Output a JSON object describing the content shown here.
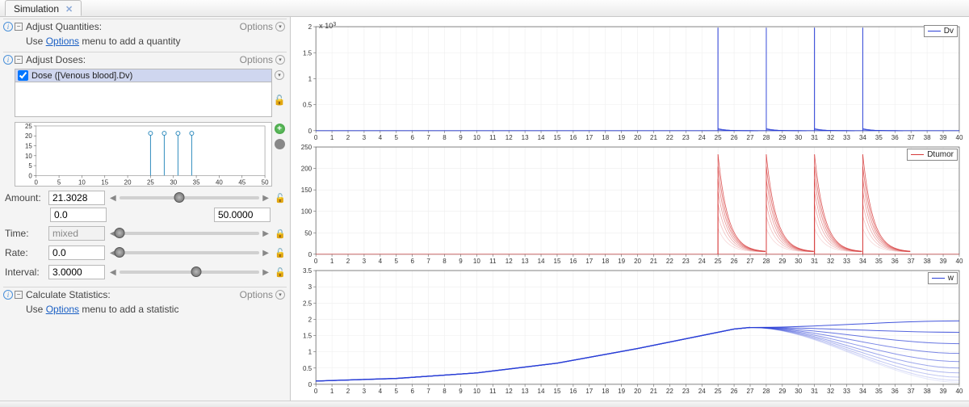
{
  "tabs": {
    "simulation": "Simulation"
  },
  "sections": {
    "quantities": {
      "title": "Adjust Quantities:",
      "hint_pre": "Use ",
      "hint_link": "Options",
      "hint_post": " menu to add a quantity",
      "options": "Options"
    },
    "doses": {
      "title": "Adjust Doses:",
      "options": "Options"
    },
    "stats": {
      "title": "Calculate Statistics:",
      "hint_pre": "Use ",
      "hint_link": "Options",
      "hint_post": " menu to add a statistic",
      "options": "Options"
    }
  },
  "dose_items": [
    {
      "label": "Dose ([Venous blood].Dv)",
      "checked": true
    }
  ],
  "mini_axis": {
    "x_ticks": [
      "0",
      "5",
      "10",
      "15",
      "20",
      "25",
      "30",
      "35",
      "40",
      "45",
      "50"
    ],
    "y_ticks": [
      "0",
      "5",
      "10",
      "15",
      "20",
      "25"
    ]
  },
  "params": {
    "amount": {
      "label": "Amount:",
      "value": "21.3028",
      "slider": 0.43,
      "min": "0.0",
      "max": "50.0000",
      "locked": false
    },
    "time": {
      "label": "Time:",
      "value": "mixed",
      "slider": 0.0,
      "locked": true
    },
    "rate": {
      "label": "Rate:",
      "value": "0.0",
      "slider": 0.0,
      "locked": false
    },
    "interval": {
      "label": "Interval:",
      "value": "3.0000",
      "slider": 0.55,
      "locked": false
    }
  },
  "chart_data": [
    {
      "type": "line",
      "title": "",
      "legend": "Dv",
      "color": "#2a3fd6",
      "xlim": [
        0,
        40
      ],
      "ylim": [
        0,
        2000
      ],
      "y_scale_label": "x 10",
      "y_scale_exp": "3",
      "x_ticks": [
        0,
        1,
        2,
        3,
        4,
        5,
        6,
        7,
        8,
        9,
        10,
        11,
        12,
        13,
        14,
        15,
        16,
        17,
        18,
        19,
        20,
        21,
        22,
        23,
        24,
        25,
        26,
        27,
        28,
        29,
        30,
        31,
        32,
        33,
        34,
        35,
        36,
        37,
        38,
        39,
        40
      ],
      "y_ticks": [
        0,
        500,
        1000,
        1500,
        2000
      ],
      "y_tick_labels": [
        "0",
        "0.5",
        "1",
        "1.5",
        "2"
      ],
      "dose_spikes_x": [
        25,
        28,
        31,
        34
      ],
      "spike_height": 1980
    },
    {
      "type": "line",
      "title": "",
      "legend": "Dtumor",
      "color": "#d63a3a",
      "xlim": [
        0,
        40
      ],
      "ylim": [
        0,
        250
      ],
      "x_ticks": [
        0,
        1,
        2,
        3,
        4,
        5,
        6,
        7,
        8,
        9,
        10,
        11,
        12,
        13,
        14,
        15,
        16,
        17,
        18,
        19,
        20,
        21,
        22,
        23,
        24,
        25,
        26,
        27,
        28,
        29,
        30,
        31,
        32,
        33,
        34,
        35,
        36,
        37,
        38,
        39,
        40
      ],
      "y_ticks": [
        0,
        50,
        100,
        150,
        200,
        250
      ],
      "dose_spikes_x": [
        25,
        28,
        31,
        34
      ],
      "spike_height": 240,
      "decay_to": 5
    },
    {
      "type": "line",
      "title": "",
      "legend": "w",
      "color": "#2a3fd6",
      "xlim": [
        0,
        40
      ],
      "ylim": [
        0,
        3.5
      ],
      "x_ticks": [
        0,
        1,
        2,
        3,
        4,
        5,
        6,
        7,
        8,
        9,
        10,
        11,
        12,
        13,
        14,
        15,
        16,
        17,
        18,
        19,
        20,
        21,
        22,
        23,
        24,
        25,
        26,
        27,
        28,
        29,
        30,
        31,
        32,
        33,
        34,
        35,
        36,
        37,
        38,
        39,
        40
      ],
      "y_ticks": [
        0,
        0.5,
        1,
        1.5,
        2,
        2.5,
        3,
        3.5
      ],
      "y_tick_labels": [
        "0",
        "0.5",
        "1",
        "1.5",
        "2",
        "2.5",
        "3",
        "3.5"
      ],
      "growth_points": [
        [
          0,
          0.1
        ],
        [
          5,
          0.18
        ],
        [
          10,
          0.35
        ],
        [
          15,
          0.65
        ],
        [
          20,
          1.1
        ],
        [
          25,
          1.6
        ],
        [
          26,
          1.7
        ],
        [
          27,
          1.75
        ]
      ],
      "fan_end_values": [
        1.95,
        1.6,
        1.25,
        0.95,
        0.7,
        0.5,
        0.35,
        0.22,
        0.12,
        0.06
      ]
    }
  ]
}
